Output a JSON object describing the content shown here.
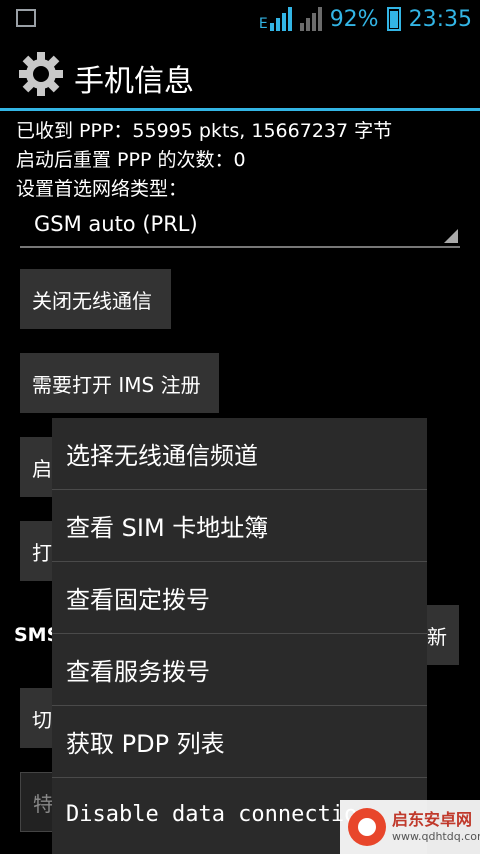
{
  "status_bar": {
    "network_label": "E",
    "battery": "92%",
    "time": "23:35"
  },
  "title": "手机信息",
  "info": {
    "ppp_received": "已收到 PPP：55995 pkts, 15667237 字节",
    "ppp_reset": "启动后重置 PPP 的次数：0",
    "network_type_label": "设置首选网络类型："
  },
  "spinner": {
    "value": "GSM auto (PRL)"
  },
  "buttons": {
    "radio_off": "关闭无线通信",
    "ims_register": "需要打开 IMS 注册",
    "partial_1": "启",
    "partial_2": "打",
    "partial_right": "新",
    "partial_3": "切",
    "partial_4": "特"
  },
  "sections": {
    "sms": "SMS"
  },
  "menu": {
    "items": [
      "选择无线通信频道",
      "查看 SIM 卡地址簿",
      "查看固定拨号",
      "查看服务拨号",
      "获取 PDP 列表",
      "Disable data connection"
    ]
  },
  "watermark": {
    "name": "启东安卓网",
    "url": "www.qdhtdq.com"
  },
  "colors": {
    "accent": "#33b5e5",
    "background": "#000000",
    "menu_bg": "#2a2a2a"
  }
}
